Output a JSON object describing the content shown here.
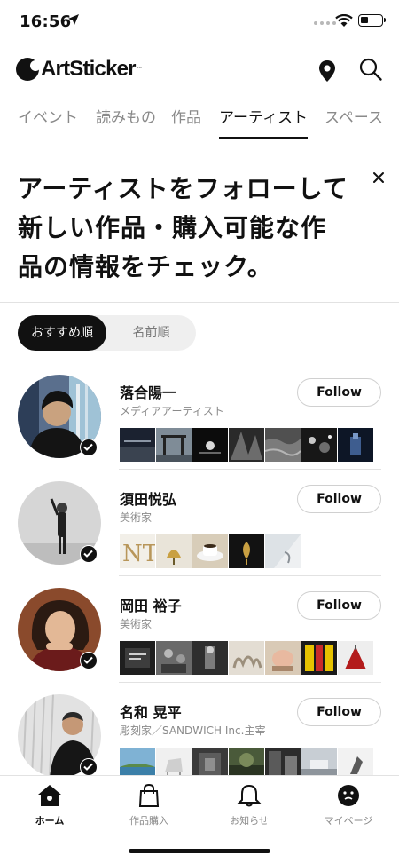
{
  "status_bar": {
    "time": "16:56"
  },
  "header": {
    "logo_text": "ArtSticker",
    "logo_tm": "™"
  },
  "tabs": [
    {
      "label": "イベント",
      "active": false
    },
    {
      "label": "読みもの",
      "active": false
    },
    {
      "label": "作品",
      "active": false
    },
    {
      "label": "アーティスト",
      "active": true
    },
    {
      "label": "スペース",
      "active": false
    }
  ],
  "banner": {
    "line1": "アーティストをフォローして",
    "line2": "新しい作品・購入可能な作",
    "line3": "品の情報をチェック。"
  },
  "sort": {
    "recommended": "おすすめ順",
    "by_name": "名前順",
    "selected": "おすすめ順"
  },
  "artists": [
    {
      "name": "落合陽一",
      "role": "メディアアーティスト",
      "follow_label": "Follow",
      "thumb_count": 7
    },
    {
      "name": "須田悦弘",
      "role": "美術家",
      "follow_label": "Follow",
      "thumb_count": 5
    },
    {
      "name": "岡田 裕子",
      "role": "美術家",
      "follow_label": "Follow",
      "thumb_count": 7
    },
    {
      "name": "名和 晃平",
      "role": "彫刻家／SANDWICH Inc.主宰",
      "follow_label": "Follow",
      "thumb_count": 7
    }
  ],
  "bottom_nav": [
    {
      "label": "ホーム",
      "icon": "home-icon",
      "active": true
    },
    {
      "label": "作品購入",
      "icon": "shopping-bag-icon",
      "active": false
    },
    {
      "label": "お知らせ",
      "icon": "bell-icon",
      "active": false
    },
    {
      "label": "マイページ",
      "icon": "profile-face-icon",
      "active": false
    }
  ],
  "colors": {
    "text": "#111111",
    "muted": "#8a8a8a",
    "divider": "#e2e2e2",
    "sort_bg": "#efefef"
  }
}
